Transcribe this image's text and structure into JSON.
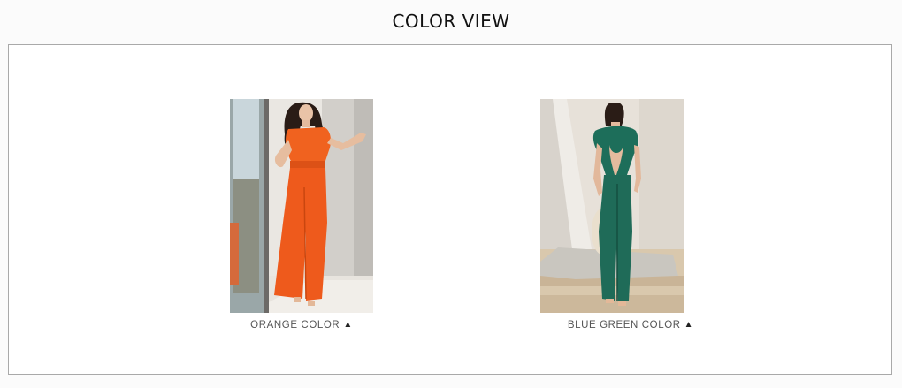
{
  "section": {
    "title": "COLOR VIEW"
  },
  "variants": [
    {
      "label": "ORANGE COLOR",
      "arrow_icon": "▲",
      "garment_color": "#ee5a1c",
      "icon_name": "triangle-up-icon"
    },
    {
      "label": "BLUE GREEN COLOR",
      "arrow_icon": "▲",
      "garment_color": "#1f6b58",
      "icon_name": "triangle-up-icon"
    }
  ]
}
